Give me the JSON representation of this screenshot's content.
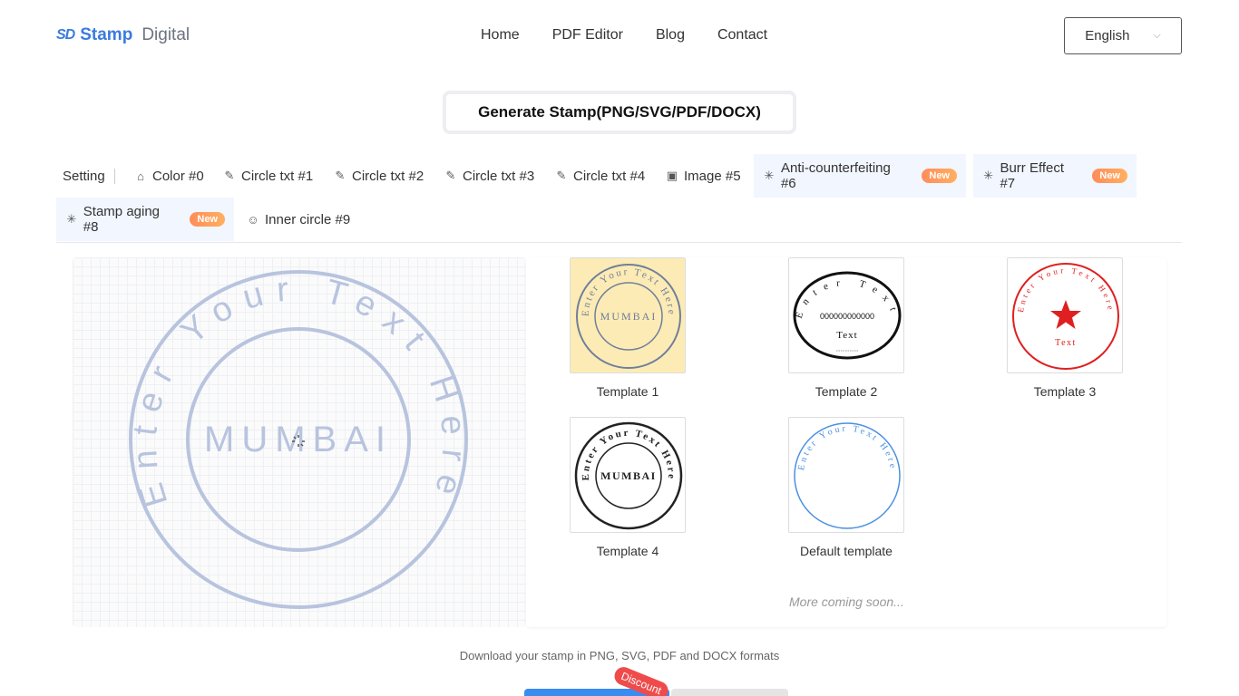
{
  "header": {
    "logo_mark": "SD",
    "logo_strong": "Stamp",
    "logo_light": "Digital",
    "nav": [
      "Home",
      "PDF Editor",
      "Blog",
      "Contact"
    ],
    "language": "English"
  },
  "generate_label": "Generate Stamp(PNG/SVG/PDF/DOCX)",
  "tabs": {
    "setting_label": "Setting",
    "items": [
      {
        "label": "Color #0",
        "icon": "home-icon"
      },
      {
        "label": "Circle txt #1",
        "icon": "pen-icon"
      },
      {
        "label": "Circle txt #2",
        "icon": "pen-icon"
      },
      {
        "label": "Circle txt #3",
        "icon": "pen-icon"
      },
      {
        "label": "Circle txt #4",
        "icon": "pen-icon"
      },
      {
        "label": "Image #5",
        "icon": "image-icon"
      },
      {
        "label": "Anti-counterfeiting #6",
        "icon": "sparkle-icon",
        "badge": "New"
      },
      {
        "label": "Burr Effect #7",
        "icon": "sparkle-icon",
        "badge": "New"
      },
      {
        "label": "Stamp aging #8",
        "icon": "sparkle-icon",
        "badge": "New"
      },
      {
        "label": "Inner circle #9",
        "icon": "smile-icon"
      }
    ]
  },
  "preview": {
    "ring_text": "Enter Your Text Here",
    "center_text": "MUMBAI",
    "color": "#b8c4de"
  },
  "templates": [
    {
      "name": "Template 1",
      "ring_text": "Enter Your Text Here",
      "center_text": "MUMBAI"
    },
    {
      "name": "Template 2",
      "ring_text": "Enter Text",
      "center_text": "000000000000",
      "sub_text": "Text"
    },
    {
      "name": "Template 3",
      "ring_text": "Enter Your Text Here",
      "center_text": "Text"
    },
    {
      "name": "Template 4",
      "ring_text": "Enter Your Text Here",
      "center_text": "MUMBAI"
    },
    {
      "name": "Default template",
      "ring_text": "Enter Your Text Here",
      "center_text": ""
    }
  ],
  "more_coming": "More coming soon...",
  "download_note": "Download your stamp in PNG, SVG, PDF and DOCX formats",
  "discount_label": "Discount",
  "colors": {
    "accent": "#3b7be0",
    "badge": "#ff8c5a",
    "template3_red": "#e02020",
    "template1_bg": "#fdebb5"
  }
}
